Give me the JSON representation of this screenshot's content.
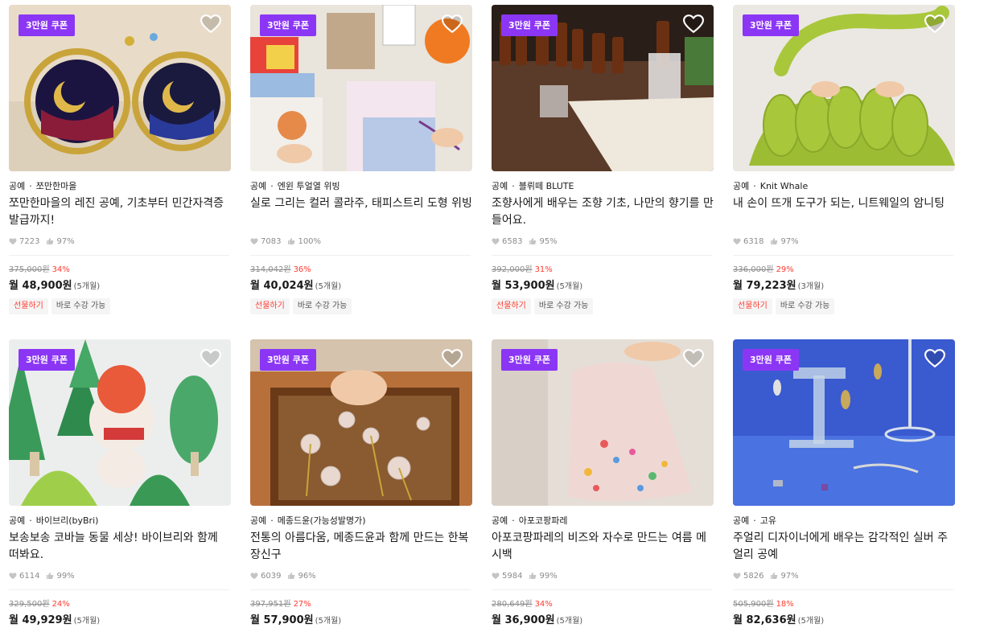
{
  "coupon_label": "3만원 쿠폰",
  "tags": {
    "gift": "선물하기",
    "instant": "바로 수강 가능"
  },
  "cards": [
    {
      "category": "공예",
      "creator": "쪼만한마을",
      "title": "쪼만한마을의 레진 공예, 기초부터 민간자격증 발급까지!",
      "likes": "7223",
      "rating": "97%",
      "original_price": "375,000원",
      "discount": "34%",
      "monthly": "월 48,900원",
      "months": "(5개월)",
      "image_desc": "resin-earrings"
    },
    {
      "category": "공예",
      "creator": "엔윈 투얼열 위빙",
      "title": "실로 그리는 컬러 콜라주, 태피스트리 도형 위빙",
      "likes": "7083",
      "rating": "100%",
      "original_price": "314,042원",
      "discount": "36%",
      "monthly": "월 40,024원",
      "months": "(5개월)",
      "image_desc": "weaving"
    },
    {
      "category": "공예",
      "creator": "블뤼떼 BLUTE",
      "title": "조향사에게 배우는 조향 기초, 나만의 향기를 만들어요.",
      "likes": "6583",
      "rating": "95%",
      "original_price": "392,000원",
      "discount": "31%",
      "monthly": "월 53,900원",
      "months": "(5개월)",
      "image_desc": "perfume"
    },
    {
      "category": "공예",
      "creator": "Knit Whale",
      "title": "내 손이 뜨개 도구가 되는, 니트웨일의 암니팅",
      "likes": "6318",
      "rating": "97%",
      "original_price": "336,000원",
      "discount": "29%",
      "monthly": "월 79,223원",
      "months": "(3개월)",
      "image_desc": "arm-knitting"
    },
    {
      "category": "공예",
      "creator": "바이브리(byBri)",
      "title": "보송보송 코바늘 동물 세상! 바이브리와 함께 떠봐요.",
      "likes": "6114",
      "rating": "99%",
      "original_price": "329,500원",
      "discount": "24%",
      "monthly": "월 49,929원",
      "months": "(5개월)",
      "image_desc": "crochet-bunny"
    },
    {
      "category": "공예",
      "creator": "메종드윤(가능성발명가)",
      "title": "전통의 아름다움, 메종드윤과 함께 만드는 한복 장신구",
      "likes": "6039",
      "rating": "96%",
      "original_price": "397,951원",
      "discount": "27%",
      "monthly": "월 57,900원",
      "months": "(5개월)",
      "image_desc": "hanbok-accessory"
    },
    {
      "category": "공예",
      "creator": "아포코팡파레",
      "title": "아포코팡파레의 비즈와 자수로 만드는 여름 메시백",
      "likes": "5984",
      "rating": "99%",
      "original_price": "280,649원",
      "discount": "34%",
      "monthly": "월 36,900원",
      "months": "(5개월)",
      "image_desc": "mesh-bag"
    },
    {
      "category": "공예",
      "creator": "고유",
      "title": "주얼리 디자이너에게 배우는 감각적인 실버 주얼리 공예",
      "likes": "5826",
      "rating": "97%",
      "original_price": "505,900원",
      "discount": "18%",
      "monthly": "월 82,636원",
      "months": "(5개월)",
      "image_desc": "silver-jewelry"
    }
  ],
  "colors": {
    "coupon": "#8b36f5",
    "discount": "#ff3b30"
  }
}
